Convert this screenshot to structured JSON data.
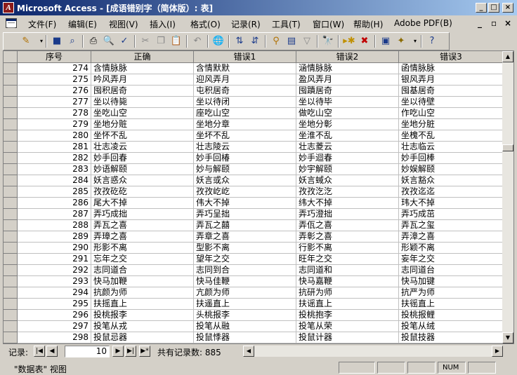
{
  "window": {
    "app_title": "Microsoft Access",
    "doc_title": "- [成语错别字（简体版）: 表]",
    "controls": [
      "_",
      "□",
      "×"
    ]
  },
  "menu": {
    "items": [
      "文件(F)",
      "编辑(E)",
      "视图(V)",
      "插入(I)",
      "格式(O)",
      "记录(R)",
      "工具(T)",
      "窗口(W)",
      "帮助(H)",
      "Adobe PDF(B)"
    ],
    "mdi_controls": [
      "_",
      "▫",
      "×"
    ]
  },
  "toolbar": {
    "icons": [
      "view-icon",
      "save-icon",
      "search-icon",
      "print-icon",
      "print-preview-icon",
      "spelling-icon",
      "cut-icon",
      "copy-icon",
      "paste-icon",
      "undo-icon",
      "hyperlink-icon",
      "sort-asc-icon",
      "sort-desc-icon",
      "filter-selection-icon",
      "filter-form-icon",
      "apply-filter-icon",
      "find-icon",
      "new-record-icon",
      "delete-record-icon",
      "database-window-icon",
      "new-object-icon",
      "help-icon"
    ]
  },
  "table": {
    "columns": [
      "序号",
      "正确",
      "错误1",
      "错误2",
      "错误3"
    ],
    "rows": [
      [
        "274",
        "含情脉脉",
        "含情默默",
        "涵情脉脉",
        "函情脉脉"
      ],
      [
        "275",
        "吟风弄月",
        "迎风弄月",
        "盈风弄月",
        "银风弄月"
      ],
      [
        "276",
        "囤积居奇",
        "屯积居奇",
        "囤蹟居奇",
        "囤基居奇"
      ],
      [
        "277",
        "坐以待毙",
        "坐以待闭",
        "坐以待毕",
        "坐以待壁"
      ],
      [
        "278",
        "坐吃山空",
        "座吃山空",
        "做吃山空",
        "作吃山空"
      ],
      [
        "279",
        "坐地分赃",
        "坐地分章",
        "坐地分彰",
        "坐地分脏"
      ],
      [
        "280",
        "坐怀不乱",
        "坐坏不乱",
        "坐淮不乱",
        "坐槐不乱"
      ],
      [
        "281",
        "壮志凌云",
        "壮志陵云",
        "壮志菱云",
        "壮志临云"
      ],
      [
        "282",
        "妙手回春",
        "妙手回椿",
        "妙手迴春",
        "妙手回棒"
      ],
      [
        "283",
        "妙语解颐",
        "妙与解颐",
        "妙宇解颐",
        "妙娱解颐"
      ],
      [
        "284",
        "妖言惑众",
        "妖言或众",
        "妖言蜮众",
        "妖言豁众"
      ],
      [
        "285",
        "孜孜矻矻",
        "孜孜屹屹",
        "孜孜汔汔",
        "孜孜迄迄"
      ],
      [
        "286",
        "尾大不掉",
        "伟大不掉",
        "纬大不掉",
        "玮大不掉"
      ],
      [
        "287",
        "弄巧成拙",
        "弄巧呈拙",
        "弄巧澄拙",
        "弄巧成茁"
      ],
      [
        "288",
        "弄瓦之喜",
        "弄瓦之囍",
        "弄佤之喜",
        "弄瓦之玺"
      ],
      [
        "289",
        "弄璋之喜",
        "弄章之喜",
        "弄彰之喜",
        "弄漳之喜"
      ],
      [
        "290",
        "形影不离",
        "型影不离",
        "行影不离",
        "形颖不离"
      ],
      [
        "291",
        "忘年之交",
        "望年之交",
        "旺年之交",
        "妄年之交"
      ],
      [
        "292",
        "志同道合",
        "志同到合",
        "志同道和",
        "志同道台"
      ],
      [
        "293",
        "快马加鞭",
        "快马佳鞭",
        "快马嘉鞭",
        "快马加键"
      ],
      [
        "294",
        "抗颜为师",
        "亢颜为师",
        "抗研为师",
        "抗严为师"
      ],
      [
        "295",
        "扶摇直上",
        "扶遥直上",
        "扶谣直上",
        "扶徭直上"
      ],
      [
        "296",
        "投桃报李",
        "头桃报李",
        "投桃抱李",
        "投桃报鲤"
      ],
      [
        "297",
        "投笔从戎",
        "投笔从融",
        "投笔从荣",
        "投笔从绒"
      ],
      [
        "298",
        "投鼠忌器",
        "投鼠悸器",
        "投鼠计器",
        "投鼠技器"
      ]
    ]
  },
  "navigation": {
    "label": "记录:",
    "current": "10",
    "count_text": "共有记录数: 885"
  },
  "status": {
    "text": "\"数据表\" 视图",
    "num": "NUM"
  }
}
